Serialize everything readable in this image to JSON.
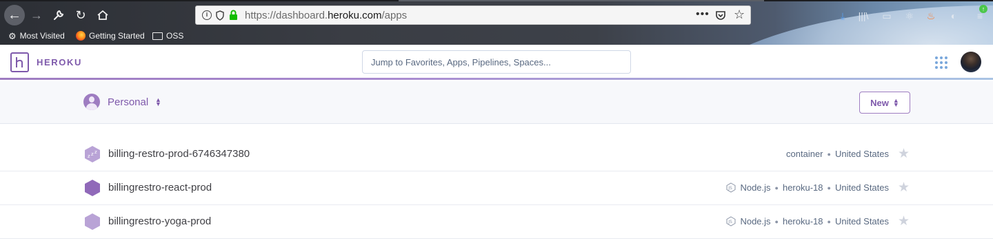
{
  "browser": {
    "url_prefix": "https://dashboard.",
    "url_domain": "heroku.com",
    "url_suffix": "/apps",
    "more_glyph": "•••",
    "bookmarks": [
      {
        "label": "Most Visited",
        "icon": "gear-icon"
      },
      {
        "label": "Getting Started",
        "icon": "firefox-icon"
      },
      {
        "label": "OSS",
        "icon": "folder-icon"
      }
    ]
  },
  "header": {
    "brand": "HEROKU",
    "search_placeholder": "Jump to Favorites, Apps, Pipelines, Spaces..."
  },
  "subheader": {
    "account_label": "Personal",
    "new_button_label": "New"
  },
  "apps": [
    {
      "name": "billing-restro-prod-6746347380",
      "status_icon": "sleeping-hex-icon",
      "stack": "container",
      "stack_label": "",
      "region": "United States",
      "language": ""
    },
    {
      "name": "billingrestro-react-prod",
      "status_icon": "hex-icon",
      "language": "Node.js",
      "stack_label": "heroku-18",
      "region": "United States"
    },
    {
      "name": "billingrestro-yoga-prod",
      "status_icon": "hex-icon",
      "language": "Node.js",
      "stack_label": "heroku-18",
      "region": "United States"
    }
  ],
  "colors": {
    "brand_purple": "#7e59ab",
    "hex_dark": "#9069b9",
    "hex_light": "#b9a3d6",
    "meta_text": "#596981"
  }
}
